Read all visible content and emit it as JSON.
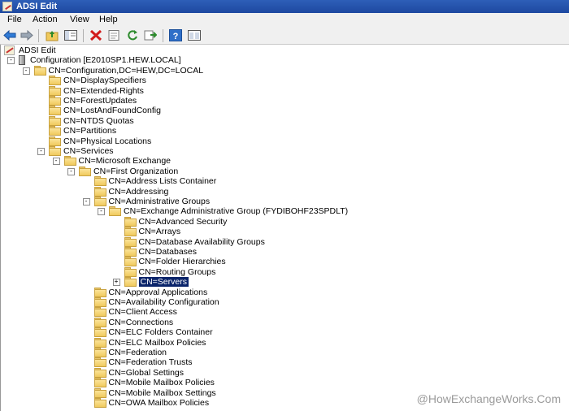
{
  "window": {
    "title": "ADSI Edit"
  },
  "menu": [
    "File",
    "Action",
    "View",
    "Help"
  ],
  "toolbar_icons": [
    "back-arrow-icon",
    "forward-arrow-icon",
    "up-folder-icon",
    "show-hide-tree-icon",
    "delete-icon",
    "properties-icon",
    "refresh-icon",
    "export-list-icon",
    "help-icon",
    "console-tree-icon"
  ],
  "tree": [
    {
      "label": "ADSI Edit",
      "level": 0,
      "icon": "adsi"
    },
    {
      "label": "Configuration [E2010SP1.HEW.LOCAL]",
      "level": 1,
      "icon": "server",
      "expander": "-"
    },
    {
      "label": "CN=Configuration,DC=HEW,DC=LOCAL",
      "level": 2,
      "icon": "folder",
      "expander": "-"
    },
    {
      "label": "CN=DisplaySpecifiers",
      "level": 3,
      "icon": "folder"
    },
    {
      "label": "CN=Extended-Rights",
      "level": 3,
      "icon": "folder"
    },
    {
      "label": "CN=ForestUpdates",
      "level": 3,
      "icon": "folder"
    },
    {
      "label": "CN=LostAndFoundConfig",
      "level": 3,
      "icon": "folder"
    },
    {
      "label": "CN=NTDS Quotas",
      "level": 3,
      "icon": "folder"
    },
    {
      "label": "CN=Partitions",
      "level": 3,
      "icon": "folder"
    },
    {
      "label": "CN=Physical Locations",
      "level": 3,
      "icon": "folder"
    },
    {
      "label": "CN=Services",
      "level": 3,
      "icon": "folder",
      "expander": "-"
    },
    {
      "label": "CN=Microsoft Exchange",
      "level": 4,
      "icon": "folder",
      "expander": "-"
    },
    {
      "label": "CN=First Organization",
      "level": 5,
      "icon": "folder",
      "expander": "-"
    },
    {
      "label": "CN=Address Lists Container",
      "level": 6,
      "icon": "folder"
    },
    {
      "label": "CN=Addressing",
      "level": 6,
      "icon": "folder"
    },
    {
      "label": "CN=Administrative Groups",
      "level": 6,
      "icon": "folder",
      "expander": "-"
    },
    {
      "label": "CN=Exchange Administrative Group (FYDIBOHF23SPDLT)",
      "level": 7,
      "icon": "folder",
      "expander": "-"
    },
    {
      "label": "CN=Advanced Security",
      "level": 8,
      "icon": "folder"
    },
    {
      "label": "CN=Arrays",
      "level": 8,
      "icon": "folder"
    },
    {
      "label": "CN=Database Availability Groups",
      "level": 8,
      "icon": "folder"
    },
    {
      "label": "CN=Databases",
      "level": 8,
      "icon": "folder"
    },
    {
      "label": "CN=Folder Hierarchies",
      "level": 8,
      "icon": "folder"
    },
    {
      "label": "CN=Routing Groups",
      "level": 8,
      "icon": "folder"
    },
    {
      "label": "CN=Servers",
      "level": 8,
      "icon": "folder",
      "expander": "+",
      "selected": true
    },
    {
      "label": "CN=Approval Applications",
      "level": 6,
      "icon": "folder"
    },
    {
      "label": "CN=Availability Configuration",
      "level": 6,
      "icon": "folder"
    },
    {
      "label": "CN=Client Access",
      "level": 6,
      "icon": "folder"
    },
    {
      "label": "CN=Connections",
      "level": 6,
      "icon": "folder"
    },
    {
      "label": "CN=ELC Folders Container",
      "level": 6,
      "icon": "folder"
    },
    {
      "label": "CN=ELC Mailbox Policies",
      "level": 6,
      "icon": "folder"
    },
    {
      "label": "CN=Federation",
      "level": 6,
      "icon": "folder"
    },
    {
      "label": "CN=Federation Trusts",
      "level": 6,
      "icon": "folder"
    },
    {
      "label": "CN=Global Settings",
      "level": 6,
      "icon": "folder"
    },
    {
      "label": "CN=Mobile Mailbox Policies",
      "level": 6,
      "icon": "folder"
    },
    {
      "label": "CN=Mobile Mailbox Settings",
      "level": 6,
      "icon": "folder"
    },
    {
      "label": "CN=OWA Mailbox Policies",
      "level": 6,
      "icon": "folder"
    }
  ],
  "watermark": "@HowExchangeWorks.Com"
}
